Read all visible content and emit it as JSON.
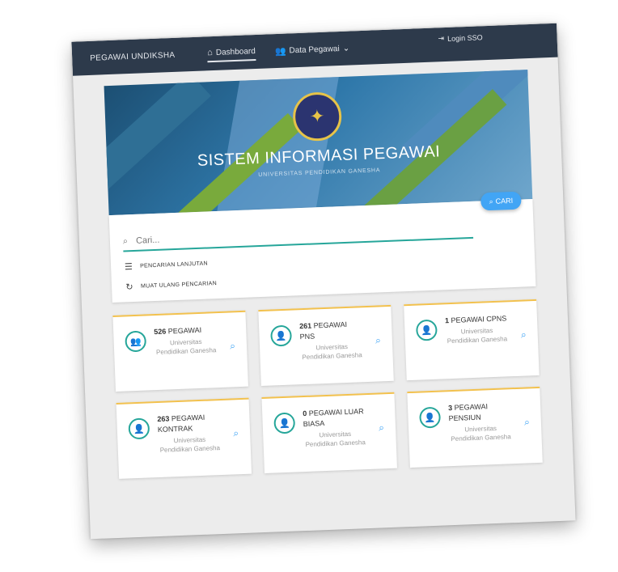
{
  "navbar": {
    "brand": "PEGAWAI UNDIKSHA",
    "items": [
      {
        "label": "Dashboard",
        "icon": "home-icon"
      },
      {
        "label": "Data Pegawai",
        "icon": "users-icon"
      }
    ],
    "login_label": "Login SSO"
  },
  "banner": {
    "title": "SISTEM INFORMASI PEGAWAI",
    "subtitle": "UNIVERSITAS PENDIDIKAN GANESHA"
  },
  "search": {
    "button_label": "CARI",
    "placeholder": "Cari...",
    "value": "",
    "advanced_label": "PENCARIAN LANJUTAN",
    "reload_label": "MUAT ULANG PENCARIAN"
  },
  "cards": [
    {
      "count": "526",
      "label": "PEGAWAI",
      "desc": "Universitas Pendidikan Ganesha"
    },
    {
      "count": "261",
      "label": "PEGAWAI PNS",
      "desc": "Universitas Pendidikan Ganesha"
    },
    {
      "count": "1",
      "label": "PEGAWAI CPNS",
      "desc": "Universitas Pendidikan Ganesha"
    },
    {
      "count": "263",
      "label": "PEGAWAI KONTRAK",
      "desc": "Universitas Pendidikan Ganesha"
    },
    {
      "count": "0",
      "label": "PEGAWAI LUAR BIASA",
      "desc": "Universitas Pendidikan Ganesha"
    },
    {
      "count": "3",
      "label": "PEGAWAI PENSIUN",
      "desc": "Universitas Pendidikan Ganesha"
    }
  ],
  "colors": {
    "navbar": "#2d3a4b",
    "accent_teal": "#26a69a",
    "accent_blue": "#42a5f5",
    "card_border": "#f2c14e"
  }
}
